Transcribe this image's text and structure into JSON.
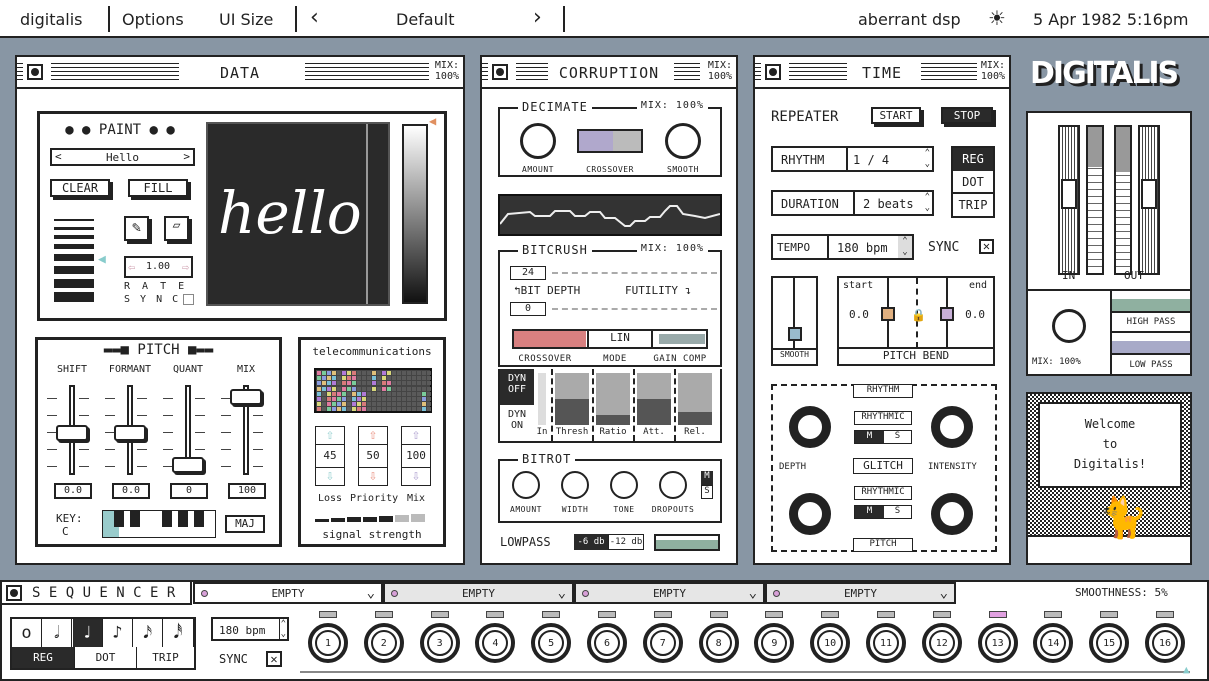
{
  "menubar": {
    "app": "digitalis",
    "options": "Options",
    "ui_size": "UI Size",
    "preset": "Default",
    "prev": "‹",
    "next": "›",
    "vendor": "aberrant dsp",
    "datetime": "5 Apr 1982 5:16pm",
    "theme_icon": "sun-icon"
  },
  "data_panel": {
    "title": "DATA",
    "mix_label": "MIX:",
    "mix_value": "100%",
    "paint": {
      "title": "PAINT",
      "preset": "Hello",
      "clear": "CLEAR",
      "fill": "FILL",
      "rate_value": "1.00",
      "rate_label": "R A T E",
      "sync_label": "S Y N C",
      "canvas_text": "hello"
    }
  },
  "pitch": {
    "title": "PITCH",
    "sliders": [
      {
        "label": "SHIFT",
        "value": "0.0",
        "position": 0.5
      },
      {
        "label": "FORMANT",
        "value": "0.0",
        "position": 0.5
      },
      {
        "label": "QUANT",
        "value": "0",
        "position": 0.1
      },
      {
        "label": "MIX",
        "value": "100",
        "position": 0.95
      }
    ],
    "key_label": "KEY:",
    "key_value": "C",
    "scale": "MAJ"
  },
  "telecom": {
    "title": "telecommunications",
    "controls": [
      {
        "label": "Loss",
        "value": "45",
        "color": "#8ecccc"
      },
      {
        "label": "Priority",
        "value": "50",
        "color": "#e88a7a"
      },
      {
        "label": "Mix",
        "value": "100",
        "color": "#a898cc"
      }
    ],
    "signal_label": "signal strength",
    "signal_level": 5,
    "signal_max": 7
  },
  "corruption": {
    "title": "CORRUPTION",
    "mix_label": "MIX:",
    "mix_value": "100%",
    "decimate": {
      "title": "DECIMATE",
      "mix": "MIX: 100%",
      "amount": "AMOUNT",
      "crossover": "CROSSOVER",
      "smooth": "SMOOTH"
    },
    "bitcrush": {
      "title": "BITCRUSH",
      "mix": "MIX: 100%",
      "bit_depth_value": "24",
      "bit_depth_label": "BIT DEPTH",
      "futility_label": "FUTILITY",
      "futility_value": "0",
      "crossover": "CROSSOVER",
      "mode": "MODE",
      "mode_value": "LIN",
      "gain_comp": "GAIN COMP"
    },
    "dynamics": {
      "off": "DYN OFF",
      "on": "DYN ON",
      "bars": [
        {
          "label": "In",
          "level": 0
        },
        {
          "label": "Thresh",
          "level": 0.5
        },
        {
          "label": "Ratio",
          "level": 0.2
        },
        {
          "label": "Att.",
          "level": 0.5
        },
        {
          "label": "Rel.",
          "level": 0.25
        }
      ]
    },
    "bitrot": {
      "title": "BITROT",
      "knobs": [
        "AMOUNT",
        "WIDTH",
        "TONE",
        "DROPOUTS"
      ],
      "m": "M",
      "s": "S"
    },
    "lowpass": {
      "label": "LOWPASS",
      "opt1": "-6 db",
      "opt2": "-12 db"
    }
  },
  "time": {
    "title": "TIME",
    "mix_label": "MIX:",
    "mix_value": "100%",
    "repeater": "REPEATER",
    "start": "START",
    "stop": "STOP",
    "rhythm_label": "RHYTHM",
    "rhythm_value": "1 / 4",
    "duration_label": "DURATION",
    "duration_value": "2 beats",
    "modes": [
      "REG",
      "DOT",
      "TRIP"
    ],
    "tempo_label": "TEMPO",
    "tempo_value": "180 bpm",
    "sync_label": "SYNC",
    "smooth_label": "SMOOTH",
    "pb_start": "start",
    "pb_end": "end",
    "pb_start_value": "0.0",
    "pb_end_value": "0.0",
    "pitch_bend": "PITCH BEND",
    "glitch": {
      "rhythm": "RHYTHM",
      "pitch": "PITCH",
      "glitch": "GLITCH",
      "depth": "DEPTH",
      "intensity": "INTENSITY",
      "rhythmic": "RHYTHMIC",
      "m": "M",
      "s": "S"
    }
  },
  "logo": "DIGITALIS",
  "master": {
    "in": "IN",
    "out": "OUT",
    "mix": "MIX: 100%",
    "high_pass": "HIGH PASS",
    "low_pass": "LOW PASS"
  },
  "welcome": {
    "line1": "Welcome",
    "line2": "to",
    "line3": "Digitalis!"
  },
  "sequencer": {
    "title": "S E Q U E N C E R",
    "slots": [
      "EMPTY",
      "EMPTY",
      "EMPTY",
      "EMPTY"
    ],
    "smoothness_label": "SMOOTHNESS:",
    "smoothness_value": "5%",
    "notes": [
      "o",
      "𝅗𝅥",
      "♩",
      "♪",
      "𝅘𝅥𝅯",
      "𝅘𝅥𝅰"
    ],
    "modes": [
      "REG",
      "DOT",
      "TRIP"
    ],
    "tempo": "180 bpm",
    "sync": "SYNC",
    "steps": [
      "1",
      "2",
      "3",
      "4",
      "5",
      "6",
      "7",
      "8",
      "9",
      "10",
      "11",
      "12",
      "13",
      "14",
      "15",
      "16"
    ],
    "active_step": 13
  }
}
